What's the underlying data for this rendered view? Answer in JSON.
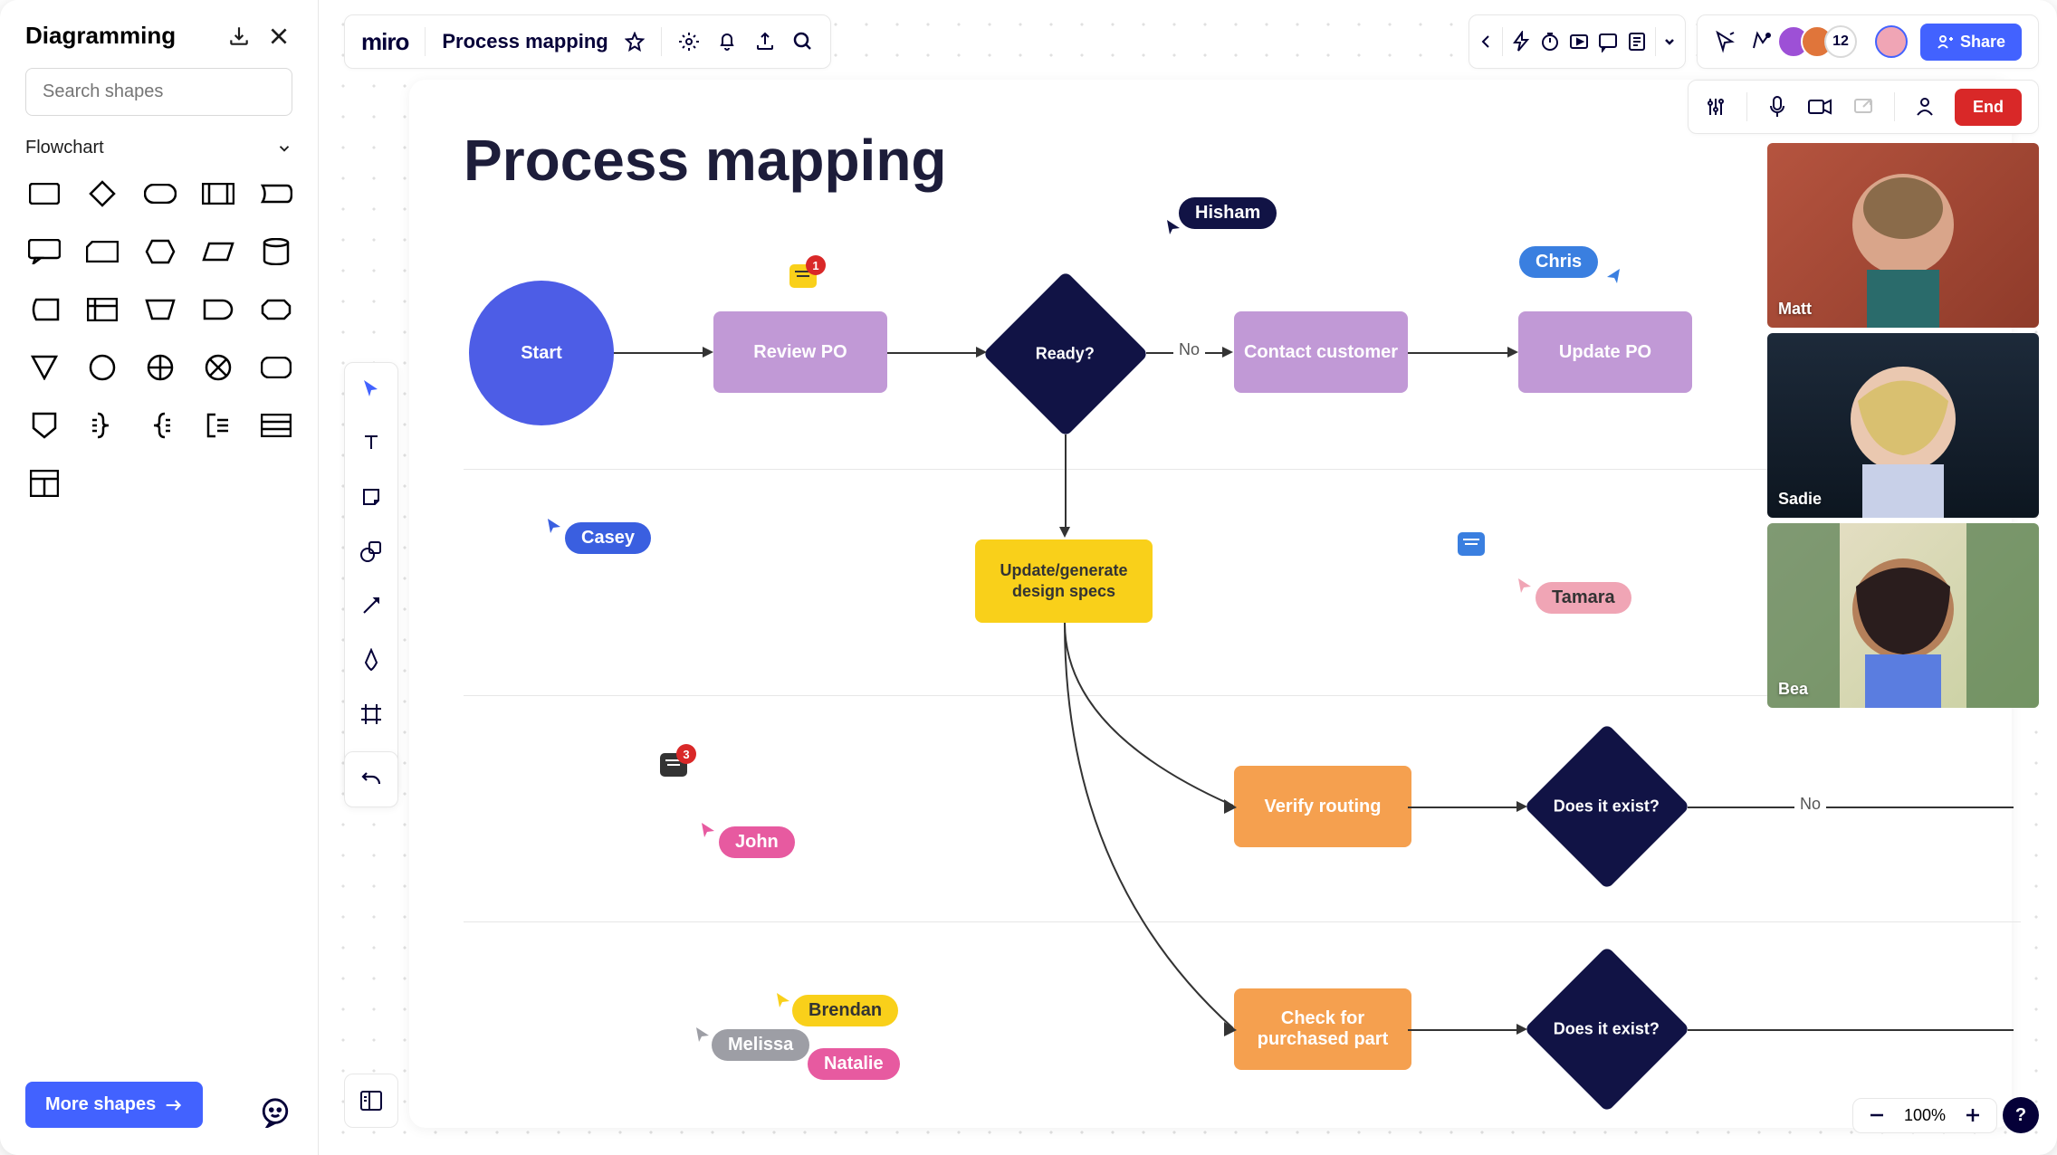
{
  "sidebar": {
    "title": "Diagramming",
    "search_placeholder": "Search shapes",
    "category": "Flowchart",
    "more_btn": "More shapes"
  },
  "topbar": {
    "logo": "miro",
    "board_name": "Process mapping",
    "avatar_count": "12",
    "share_label": "Share",
    "end_label": "End"
  },
  "zoom": {
    "level": "100%"
  },
  "canvas": {
    "title": "Process mapping",
    "nodes": {
      "start": "Start",
      "review_po": "Review PO",
      "ready": "Ready?",
      "contact_customer": "Contact customer",
      "update_po": "Update PO",
      "update_specs": "Update/generate design specs",
      "verify_routing": "Verify routing",
      "check_part": "Check for purchased part",
      "exist1": "Does it exist?",
      "exist2": "Does it exist?"
    },
    "edge_labels": {
      "no1": "No",
      "no2": "No"
    },
    "comments": {
      "c1": "1",
      "c2": "3"
    },
    "cursors": {
      "hisham": "Hisham",
      "chris": "Chris",
      "casey": "Casey",
      "tamara": "Tamara",
      "john": "John",
      "melissa": "Melissa",
      "brendan": "Brendan",
      "natalie": "Natalie"
    }
  },
  "videos": {
    "v1": "Matt",
    "v2": "Sadie",
    "v3": "Bea"
  },
  "colors": {
    "primary": "#4262ff",
    "purple": "#c199d6",
    "navy": "#111345",
    "yellow": "#f9d01a",
    "orange": "#f5a04f",
    "pink": "#e75aa0",
    "red": "#d92828"
  }
}
